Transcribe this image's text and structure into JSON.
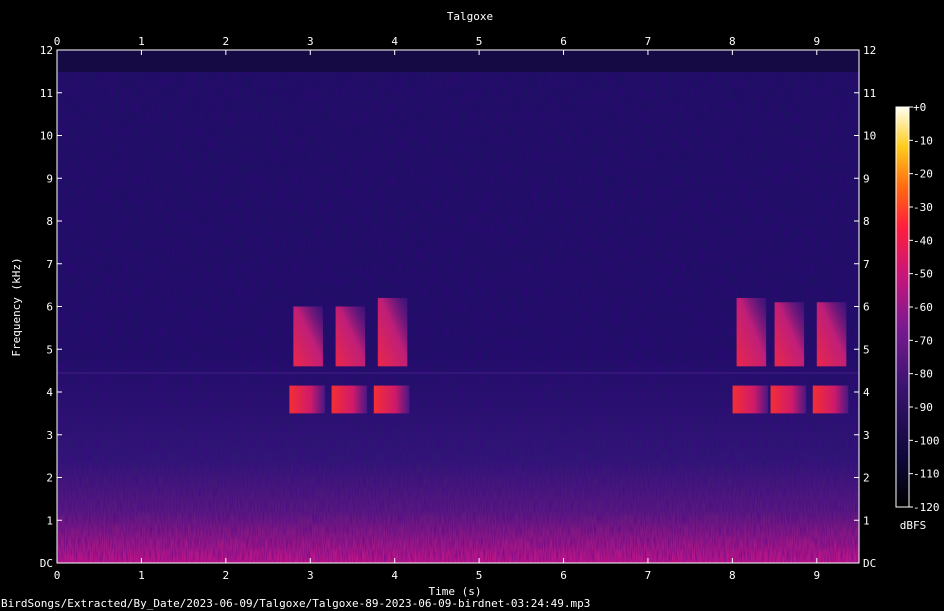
{
  "chart_data": {
    "type": "heatmap",
    "title": "Talgoxe",
    "xlabel": "Time (s)",
    "ylabel": "Frequency (kHz)",
    "xlim": [
      0,
      9.5
    ],
    "ylim": [
      0,
      12
    ],
    "x_ticks": [
      "0",
      "1",
      "2",
      "3",
      "4",
      "5",
      "6",
      "7",
      "8",
      "9"
    ],
    "y_ticks": [
      "DC",
      "1",
      "2",
      "3",
      "4",
      "5",
      "6",
      "7",
      "8",
      "9",
      "10",
      "11",
      "12"
    ],
    "colorbar": {
      "label": "dBFS",
      "range": [
        -120,
        0
      ],
      "ticks": [
        "+0",
        "-10",
        "-20",
        "-30",
        "-40",
        "-50",
        "-60",
        "-70",
        "-80",
        "-90",
        "-100",
        "-110",
        "-120"
      ]
    },
    "events": [
      {
        "t_start": 2.8,
        "t_end": 3.15,
        "f_low": 3.6,
        "f_high": 6.0,
        "peak_db": -55
      },
      {
        "t_start": 3.3,
        "t_end": 3.65,
        "f_low": 3.6,
        "f_high": 6.0,
        "peak_db": -55
      },
      {
        "t_start": 3.8,
        "t_end": 4.15,
        "f_low": 3.6,
        "f_high": 6.2,
        "peak_db": -55
      },
      {
        "t_start": 8.05,
        "t_end": 8.4,
        "f_low": 3.6,
        "f_high": 6.2,
        "peak_db": -55
      },
      {
        "t_start": 8.5,
        "t_end": 8.85,
        "f_low": 3.6,
        "f_high": 6.1,
        "peak_db": -55
      },
      {
        "t_start": 9.0,
        "t_end": 9.35,
        "f_low": 3.6,
        "f_high": 6.1,
        "peak_db": -55
      }
    ],
    "colors": {
      "background": "#000000",
      "noise": "#1a0d5c",
      "low_band": "#c4168a",
      "call": "#ff2a3a"
    }
  },
  "footer": {
    "filename": "BirdSongs/Extracted/By_Date/2023-06-09/Talgoxe/Talgoxe-89-2023-06-09-birdnet-03:24:49.mp3"
  }
}
